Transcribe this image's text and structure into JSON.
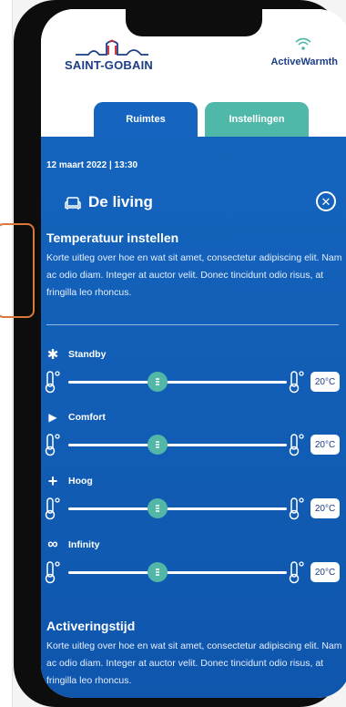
{
  "brand": {
    "company": "SAINT-GOBAIN",
    "product": "ActiveWarmth"
  },
  "tabs": [
    {
      "label": "Ruimtes",
      "active": true
    },
    {
      "label": "Instellingen",
      "active": false
    }
  ],
  "datetime": "12 maart 2022 | 13:30",
  "room": {
    "title": "De living",
    "icon": "sofa-icon",
    "close_icon": "close-circle-icon"
  },
  "temperature_section": {
    "title": "Temperatuur instellen",
    "description": "Korte uitleg over hoe en wat sit amet, consectetur adipiscing elit. Nam ac odio diam. Integer at auctor velit. Donec tincidunt odio risus, at fringilla leo rhoncus."
  },
  "modes": [
    {
      "label": "Standby",
      "icon": "snowflake-icon",
      "glyph": "✱",
      "value": "20°C",
      "slider_fraction": 0.41
    },
    {
      "label": "Comfort",
      "icon": "play-icon",
      "glyph": "▶",
      "value": "20°C",
      "slider_fraction": 0.41
    },
    {
      "label": "Hoog",
      "icon": "plus-icon",
      "glyph": "+",
      "value": "20°C",
      "slider_fraction": 0.41
    },
    {
      "label": "Infinity",
      "icon": "infinity-icon",
      "glyph": "∞",
      "value": "20°C",
      "slider_fraction": 0.41
    }
  ],
  "activation_section": {
    "title": "Activeringstijd",
    "description": "Korte uitleg over hoe en wat sit amet, consectetur adipiscing elit. Nam ac odio diam. Integer at auctor velit. Donec tincidunt odio risus, at fringilla leo rhoncus."
  },
  "colors": {
    "primary": "#1565c0",
    "accent": "#4fb8a9",
    "brand_text": "#1b3c86",
    "knob": "#52b7a6"
  }
}
